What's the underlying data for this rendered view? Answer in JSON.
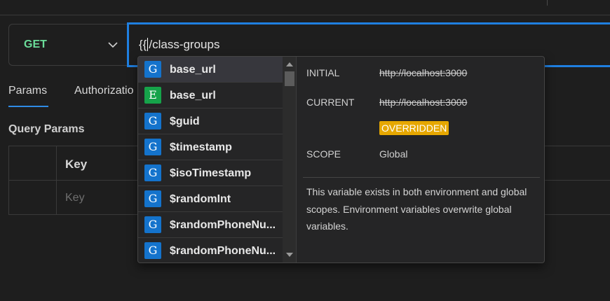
{
  "request": {
    "method": "GET",
    "url_before_caret": "{{",
    "url_after_caret": "/class-groups"
  },
  "tabs": [
    {
      "label": "Params",
      "active": true
    },
    {
      "label": "Authorizatio",
      "active": false
    }
  ],
  "query_params": {
    "title": "Query Params",
    "key_header": "Key",
    "key_placeholder": "Key"
  },
  "autocomplete": {
    "items": [
      {
        "badge": "G",
        "scope": "global",
        "label": "base_url",
        "selected": true
      },
      {
        "badge": "E",
        "scope": "environment",
        "label": "base_url"
      },
      {
        "badge": "G",
        "scope": "global",
        "label": "$guid"
      },
      {
        "badge": "G",
        "scope": "global",
        "label": "$timestamp"
      },
      {
        "badge": "G",
        "scope": "global",
        "label": "$isoTimestamp"
      },
      {
        "badge": "G",
        "scope": "global",
        "label": "$randomInt"
      },
      {
        "badge": "G",
        "scope": "global",
        "label": "$randomPhoneNu..."
      },
      {
        "badge": "G",
        "scope": "global",
        "label": "$randomPhoneNu..."
      }
    ],
    "detail": {
      "initial_label": "INITIAL",
      "initial_value": "http://localhost:3000",
      "current_label": "CURRENT",
      "current_value": "http://localhost:3000",
      "overridden_badge": "OVERRIDDEN",
      "scope_label": "SCOPE",
      "scope_value": "Global",
      "description": "This variable exists in both environment and global scopes. Environment variables overwrite global variables."
    }
  },
  "colors": {
    "accent": "#1f7fe0",
    "method_get": "#6bdd9a",
    "badge_global": "#1473cc",
    "badge_environment": "#16a34a",
    "overridden": "#e6a700"
  }
}
